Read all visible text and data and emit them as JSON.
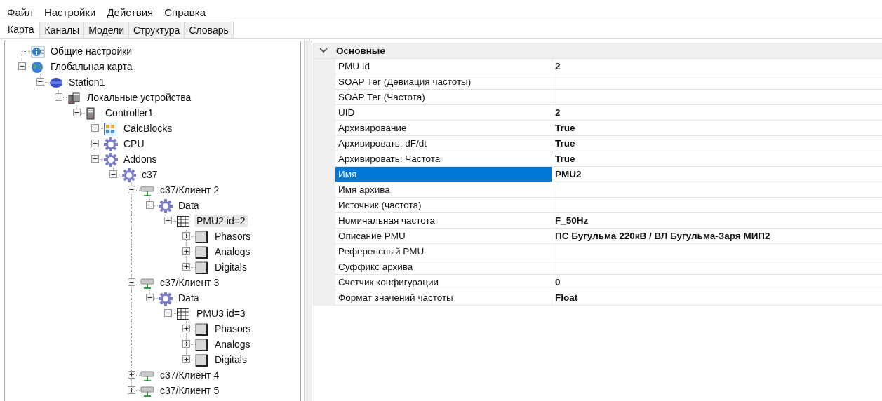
{
  "menu": [
    "Файл",
    "Настройки",
    "Действия",
    "Справка"
  ],
  "tabs": [
    {
      "label": "Карта",
      "selected": true
    },
    {
      "label": "Каналы",
      "selected": false
    },
    {
      "label": "Модели",
      "selected": false
    },
    {
      "label": "Структура",
      "selected": false
    },
    {
      "label": "Словарь",
      "selected": false
    }
  ],
  "tree": [
    {
      "label": "Общие настройки",
      "kind": "info",
      "expandable": false,
      "selected": false
    },
    {
      "label": "Глобальная карта",
      "kind": "globe",
      "expandable": true,
      "expanded": true,
      "selected": false,
      "children": [
        {
          "label": "Station1",
          "kind": "station",
          "expandable": true,
          "expanded": true,
          "selected": false,
          "children": [
            {
              "label": "Локальные устройства",
              "kind": "devices",
              "expandable": true,
              "expanded": true,
              "selected": false,
              "children": [
                {
                  "label": "Controller1",
                  "kind": "controller",
                  "expandable": true,
                  "expanded": true,
                  "selected": false,
                  "children": [
                    {
                      "label": "CalcBlocks",
                      "kind": "blocks",
                      "expandable": true,
                      "expanded": false,
                      "selected": false
                    },
                    {
                      "label": "CPU",
                      "kind": "gear",
                      "expandable": true,
                      "expanded": false,
                      "selected": false
                    },
                    {
                      "label": "Addons",
                      "kind": "gear",
                      "expandable": true,
                      "expanded": true,
                      "selected": false,
                      "children": [
                        {
                          "label": "c37",
                          "kind": "gear",
                          "expandable": true,
                          "expanded": true,
                          "selected": false,
                          "children": [
                            {
                              "label": "c37/Клиент 2",
                              "kind": "client",
                              "expandable": true,
                              "expanded": true,
                              "selected": false,
                              "children": [
                                {
                                  "label": "Data",
                                  "kind": "gear",
                                  "expandable": true,
                                  "expanded": true,
                                  "selected": false,
                                  "children": [
                                    {
                                      "label": "PMU2 id=2",
                                      "kind": "table",
                                      "expandable": true,
                                      "expanded": true,
                                      "selected": true,
                                      "children": [
                                        {
                                          "label": "Phasors",
                                          "kind": "folder",
                                          "expandable": true,
                                          "expanded": false,
                                          "selected": false
                                        },
                                        {
                                          "label": "Analogs",
                                          "kind": "folder",
                                          "expandable": true,
                                          "expanded": false,
                                          "selected": false
                                        },
                                        {
                                          "label": "Digitals",
                                          "kind": "folder",
                                          "expandable": true,
                                          "expanded": false,
                                          "selected": false
                                        }
                                      ]
                                    }
                                  ]
                                }
                              ]
                            },
                            {
                              "label": "c37/Клиент 3",
                              "kind": "client",
                              "expandable": true,
                              "expanded": true,
                              "selected": false,
                              "children": [
                                {
                                  "label": "Data",
                                  "kind": "gear",
                                  "expandable": true,
                                  "expanded": true,
                                  "selected": false,
                                  "children": [
                                    {
                                      "label": "PMU3 id=3",
                                      "kind": "table",
                                      "expandable": true,
                                      "expanded": true,
                                      "selected": false,
                                      "children": [
                                        {
                                          "label": "Phasors",
                                          "kind": "folder",
                                          "expandable": true,
                                          "expanded": false,
                                          "selected": false
                                        },
                                        {
                                          "label": "Analogs",
                                          "kind": "folder",
                                          "expandable": true,
                                          "expanded": false,
                                          "selected": false
                                        },
                                        {
                                          "label": "Digitals",
                                          "kind": "folder",
                                          "expandable": true,
                                          "expanded": false,
                                          "selected": false
                                        }
                                      ]
                                    }
                                  ]
                                }
                              ]
                            },
                            {
                              "label": "c37/Клиент 4",
                              "kind": "client",
                              "expandable": true,
                              "expanded": false,
                              "selected": false
                            },
                            {
                              "label": "c37/Клиент 5",
                              "kind": "client",
                              "expandable": true,
                              "expanded": false,
                              "selected": false
                            }
                          ]
                        }
                      ]
                    }
                  ]
                }
              ]
            }
          ]
        }
      ]
    }
  ],
  "properties": {
    "category": {
      "label": "Основные",
      "expanded": true
    },
    "rows": [
      {
        "name": "PMU Id",
        "value": "2",
        "selected": false
      },
      {
        "name": "SOAP Тег (Девиация частоты)",
        "selected": false
      },
      {
        "name": "SOAP Тег (Частота)",
        "selected": false
      },
      {
        "name": "UID",
        "value": "2",
        "selected": false
      },
      {
        "name": "Архивирование",
        "value": "True",
        "selected": false
      },
      {
        "name": "Архивировать: dF/dt",
        "value": "True",
        "selected": false
      },
      {
        "name": "Архивировать: Частота",
        "value": "True",
        "selected": false
      },
      {
        "name": "Имя",
        "value": "PMU2",
        "selected": true
      },
      {
        "name": "Имя архива",
        "selected": false
      },
      {
        "name": "Источник (частота)",
        "selected": false
      },
      {
        "name": "Номинальная частота",
        "value": "F_50Hz",
        "selected": false
      },
      {
        "name": "Описание PMU",
        "value": "ПС Бугульма 220кВ / ВЛ Бугульма-Заря МИП2",
        "selected": false
      },
      {
        "name": "Референсный PMU",
        "selected": false
      },
      {
        "name": "Суффикс архива",
        "selected": false
      },
      {
        "name": "Счетчик конфигурации",
        "value": "0",
        "selected": false
      },
      {
        "name": "Формат значений частоты",
        "value": "Float",
        "selected": false
      }
    ]
  }
}
